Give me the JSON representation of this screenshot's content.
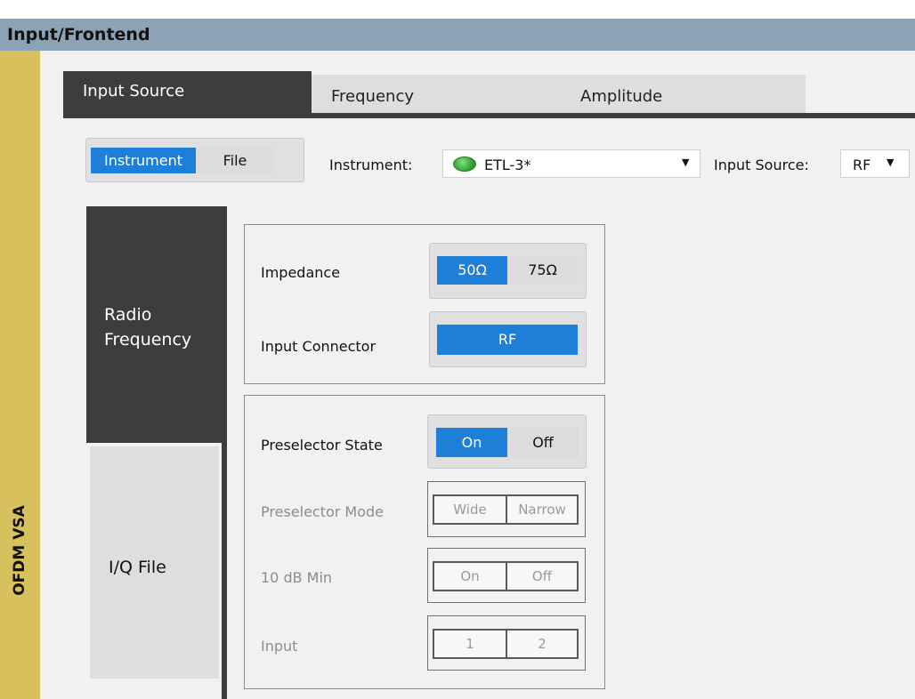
{
  "window": {
    "title": "Input/Frontend"
  },
  "sidebar": {
    "label": "OFDM VSA"
  },
  "tabs": [
    {
      "label": "Input Source",
      "active": true
    },
    {
      "label": "Frequency",
      "active": false
    },
    {
      "label": "Amplitude",
      "active": false
    }
  ],
  "source_toggle": {
    "instrument": "Instrument",
    "file": "File",
    "selected": "Instrument"
  },
  "instrument": {
    "label": "Instrument:",
    "value": "ETL-3*",
    "status_color": "#3cb43c"
  },
  "input_source": {
    "label": "Input Source:",
    "value": "RF"
  },
  "vertical_tabs": [
    {
      "label": "Radio Frequency",
      "line1": "Radio",
      "line2": "Frequency",
      "active": true
    },
    {
      "label": "I/Q File",
      "active": false
    }
  ],
  "impedance": {
    "label": "Impedance",
    "options": [
      "50Ω",
      "75Ω"
    ],
    "selected": "50Ω"
  },
  "input_connector": {
    "label": "Input Connector",
    "value": "RF"
  },
  "preselector_state": {
    "label": "Preselector State",
    "options": [
      "On",
      "Off"
    ],
    "selected": "On"
  },
  "preselector_mode": {
    "label": "Preselector Mode",
    "options": [
      "Wide",
      "Narrow"
    ],
    "enabled": false
  },
  "min_10db": {
    "label": "10 dB Min",
    "options": [
      "On",
      "Off"
    ],
    "enabled": false
  },
  "input": {
    "label": "Input",
    "options": [
      "1",
      "2"
    ],
    "enabled": false
  },
  "colors": {
    "accent": "#1e7fd8",
    "titlebar": "#8ca3b7",
    "sidebar": "#d8c15c",
    "dark_tab": "#3d3d3d"
  }
}
